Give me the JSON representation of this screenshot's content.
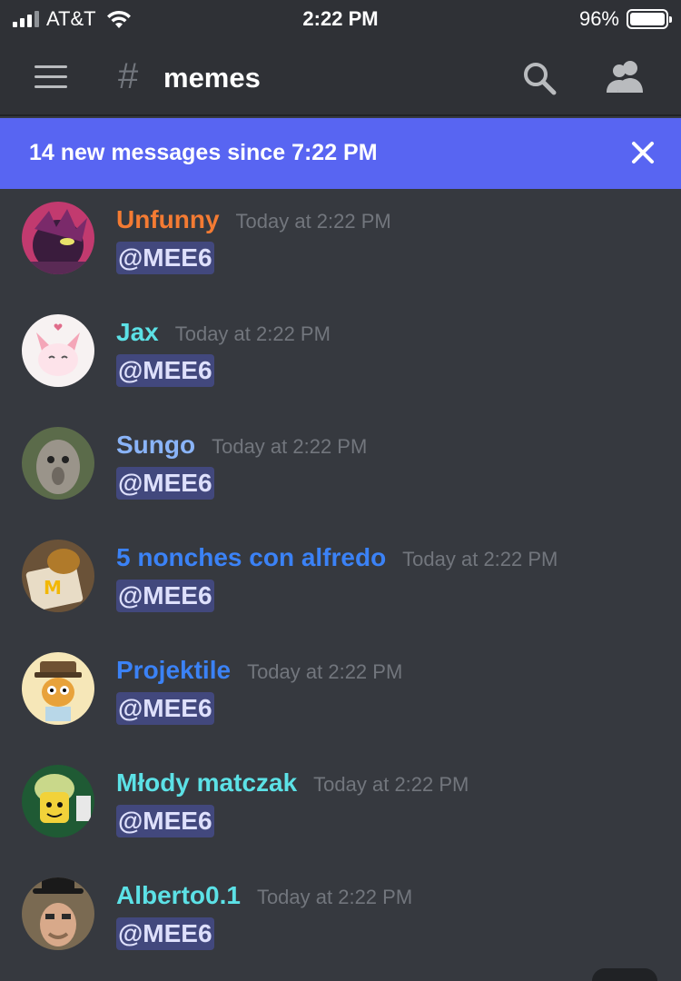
{
  "status_bar": {
    "carrier": "AT&T",
    "time": "2:22 PM",
    "battery": "96%",
    "battery_level": 0.96
  },
  "header": {
    "channel_hash": "#",
    "channel_name": "memes"
  },
  "banner": {
    "text": "14 new messages since 7:22 PM"
  },
  "messages": [
    {
      "username": "Unfunny",
      "color": "#f47b33",
      "timestamp": "Today at 2:22 PM",
      "mention": "@MEE6"
    },
    {
      "username": "Jax",
      "color": "#5ce1e6",
      "timestamp": "Today at 2:22 PM",
      "mention": "@MEE6"
    },
    {
      "username": "Sungo",
      "color": "#8ab4f8",
      "timestamp": "Today at 2:22 PM",
      "mention": "@MEE6"
    },
    {
      "username": "5 nonches con alfredo",
      "color": "#3b82f6",
      "timestamp": "Today at 2:22 PM",
      "mention": "@MEE6"
    },
    {
      "username": "Projektile",
      "color": "#3b82f6",
      "timestamp": "Today at 2:22 PM",
      "mention": "@MEE6"
    },
    {
      "username": "Młody matczak",
      "color": "#5ce1e6",
      "timestamp": "Today at 2:22 PM",
      "mention": "@MEE6"
    },
    {
      "username": "Alberto0.1",
      "color": "#5ce1e6",
      "timestamp": "Today at 2:22 PM",
      "mention": "@MEE6"
    }
  ],
  "icons": {
    "menu": "hamburger-icon",
    "search": "search-icon",
    "members": "members-icon",
    "close": "close-icon"
  }
}
